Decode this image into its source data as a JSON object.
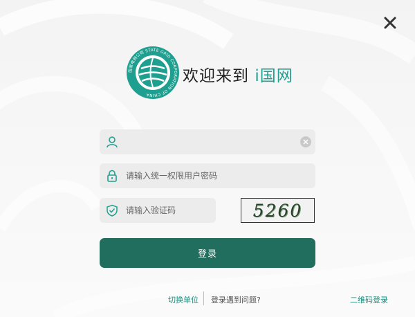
{
  "header": {
    "welcome_text": "欢迎来到",
    "brand_name": "i国网",
    "logo_ring_text": "国家电网公司 STATE GRID CORPORATION OF CHINA"
  },
  "form": {
    "username": {
      "value": "",
      "placeholder": ""
    },
    "password": {
      "value": "",
      "placeholder": "请输入统一权限用户密码"
    },
    "verify_code": {
      "value": "",
      "placeholder": "请输入验证码"
    },
    "captcha_text": "5260",
    "login_label": "登录"
  },
  "footer": {
    "switch_unit": "切换单位",
    "login_problem": "登录遇到问题?",
    "qr_login": "二维码登录"
  },
  "colors": {
    "brand": "#1f9f8f",
    "button": "#226e5e",
    "field_bg": "#ececec"
  },
  "icons": {
    "close": "close-icon",
    "user": "user-icon",
    "lock": "lock-icon",
    "shield": "shield-check-icon",
    "clear": "clear-icon"
  }
}
